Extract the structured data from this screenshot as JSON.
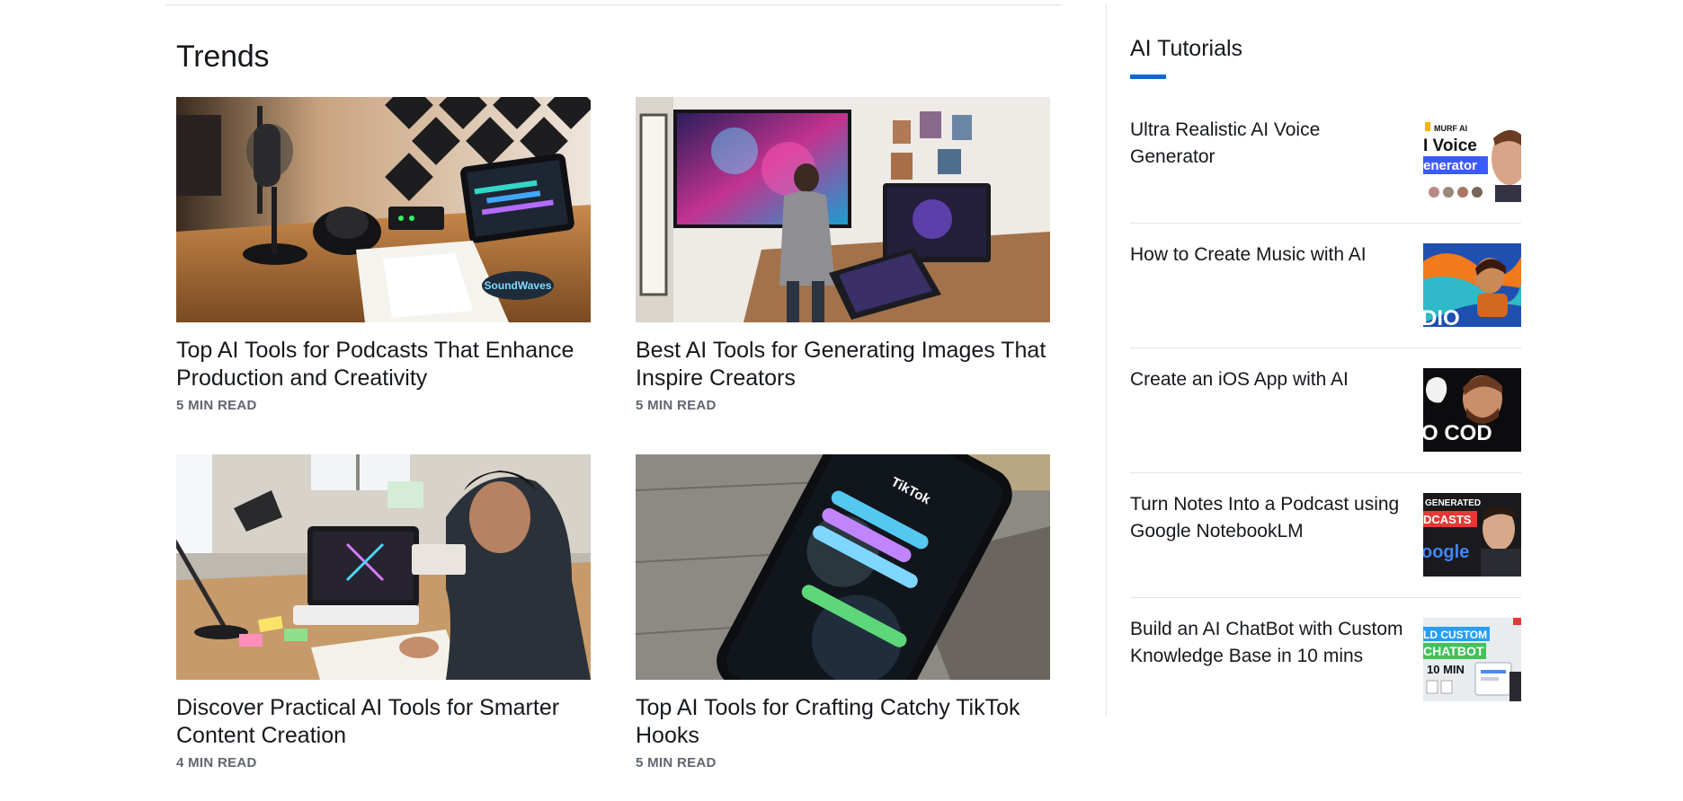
{
  "trends": {
    "title": "Trends",
    "articles": [
      {
        "title": "Top AI Tools for Podcasts That Enhance Production and Creativity",
        "meta": "5 MIN READ"
      },
      {
        "title": "Best AI Tools for Generating Images That Inspire Creators",
        "meta": "5 MIN READ"
      },
      {
        "title": "Discover Practical AI Tools for Smarter Content Creation",
        "meta": "4 MIN READ"
      },
      {
        "title": "Top AI Tools for Crafting Catchy TikTok Hooks",
        "meta": "5 MIN READ"
      }
    ]
  },
  "tutorials": {
    "title": "AI Tutorials",
    "accent_color": "#0b66d6",
    "items": [
      {
        "title": "Ultra Realistic AI Voice Generator",
        "thumb_text": [
          "MURF AI",
          "I Voice",
          "enerator"
        ]
      },
      {
        "title": "How to Create Music with AI",
        "thumb_text": [
          "DIO"
        ]
      },
      {
        "title": "Create an iOS App with AI",
        "thumb_text": [
          "O COD"
        ]
      },
      {
        "title": "Turn Notes Into a Podcast using Google NotebookLM",
        "thumb_text": [
          "GENERATED",
          "DCASTS",
          "oogle"
        ]
      },
      {
        "title": "Build an AI ChatBot with Custom Knowledge Base in 10 mins",
        "thumb_text": [
          "LD CUSTOM",
          "CHATBOT",
          "10 MIN"
        ]
      }
    ]
  },
  "images": {
    "podcast_photo": "podcast-studio-photo",
    "image_gen_photo": "image-generation-photo",
    "content_photo": "content-creation-photo",
    "tiktok_photo": "tiktok-phone-photo",
    "sticker_text": "SoundWaves",
    "tiktok_logo_text": "TikTok"
  }
}
